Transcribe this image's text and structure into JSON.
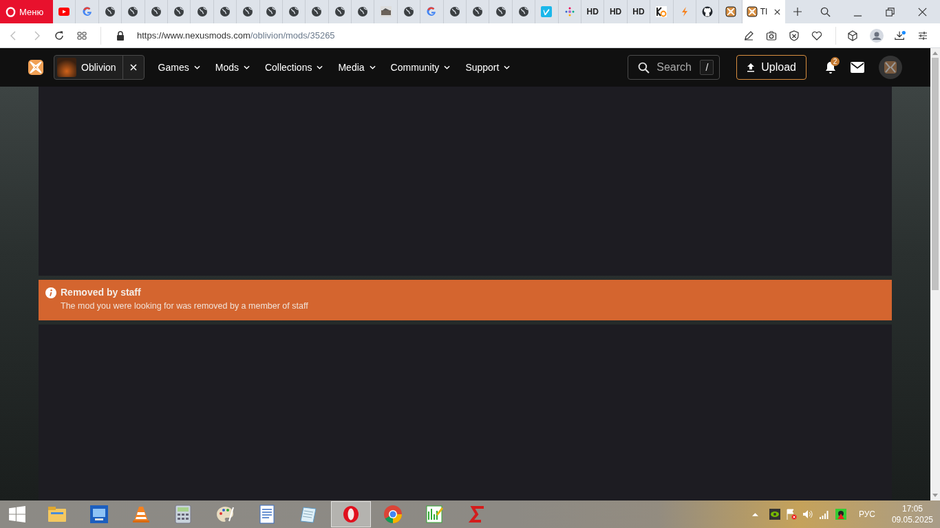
{
  "browser": {
    "menu_label": "Меню",
    "tabs": [
      {
        "kind": "youtube",
        "selected": false
      },
      {
        "kind": "google",
        "selected": false
      },
      {
        "kind": "globe",
        "selected": false
      },
      {
        "kind": "globe",
        "selected": false
      },
      {
        "kind": "globe",
        "selected": false
      },
      {
        "kind": "globe",
        "selected": false
      },
      {
        "kind": "globe",
        "selected": false
      },
      {
        "kind": "globe",
        "selected": false
      },
      {
        "kind": "globe",
        "selected": false
      },
      {
        "kind": "globe",
        "selected": false
      },
      {
        "kind": "globe",
        "selected": false
      },
      {
        "kind": "globe",
        "selected": false
      },
      {
        "kind": "globe",
        "selected": false
      },
      {
        "kind": "globe",
        "selected": false
      },
      {
        "kind": "image",
        "selected": false
      },
      {
        "kind": "globe",
        "selected": false
      },
      {
        "kind": "google",
        "selected": false
      },
      {
        "kind": "globe",
        "selected": false
      },
      {
        "kind": "globe",
        "selected": false
      },
      {
        "kind": "globe",
        "selected": false
      },
      {
        "kind": "globe",
        "selected": false
      },
      {
        "kind": "vimeo",
        "selected": false
      },
      {
        "kind": "dots",
        "selected": false
      },
      {
        "kind": "text",
        "label": "HD",
        "selected": false
      },
      {
        "kind": "text",
        "label": "HD",
        "selected": false
      },
      {
        "kind": "text",
        "label": "HD",
        "selected": false
      },
      {
        "kind": "kg",
        "selected": false
      },
      {
        "kind": "bolt",
        "selected": false
      },
      {
        "kind": "github",
        "selected": false
      },
      {
        "kind": "nexus",
        "selected": false
      },
      {
        "kind": "nexus",
        "label": "TI",
        "selected": true
      }
    ],
    "url": {
      "host": "https://www.nexusmods.com",
      "path": "/oblivion/mods/35265"
    }
  },
  "site_nav": {
    "game": "Oblivion",
    "menus": [
      "Games",
      "Mods",
      "Collections",
      "Media",
      "Community",
      "Support"
    ],
    "search_placeholder": "Search",
    "search_shortcut": "/",
    "upload": "Upload",
    "notification_count": "2"
  },
  "notice": {
    "title": "Removed by staff",
    "message": "The mod you were looking for was removed by a member of staff"
  },
  "taskbar": {
    "apps": [
      {
        "kind": "explorer",
        "selected": false
      },
      {
        "kind": "control-panel",
        "selected": false
      },
      {
        "kind": "vlc",
        "selected": false
      },
      {
        "kind": "calculator",
        "selected": false
      },
      {
        "kind": "paint",
        "selected": false
      },
      {
        "kind": "wordpad",
        "selected": false
      },
      {
        "kind": "notes",
        "selected": false
      },
      {
        "kind": "opera",
        "selected": true
      },
      {
        "kind": "chrome",
        "selected": false
      },
      {
        "kind": "chart",
        "selected": false
      },
      {
        "kind": "s-logo",
        "selected": false
      }
    ],
    "language": "РУС",
    "time": "17:05",
    "date": "09.05.2025"
  }
}
